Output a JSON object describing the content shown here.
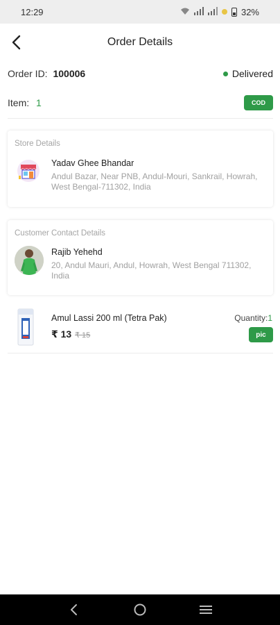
{
  "status_bar": {
    "time": "12:29",
    "battery": "32%"
  },
  "header": {
    "title": "Order Details"
  },
  "order": {
    "id_label": "Order ID:",
    "id_value": "100006",
    "status": "Delivered",
    "item_label": "Item:",
    "item_count": "1",
    "payment_badge": "COD"
  },
  "store": {
    "title": "Store Details",
    "name": "Yadav Ghee Bhandar",
    "address": "Andul Bazar, Near PNB, Andul-Mouri, Sankrail, Howrah, West Bengal-711302, India"
  },
  "customer": {
    "title": "Customer Contact Details",
    "name": "Rajib Yehehd",
    "address": "20, Andul Mauri, Andul, Howrah, West Bengal 711302, India"
  },
  "product": {
    "name": "Amul Lassi 200 ml (Tetra Pak)",
    "price": "₹ 13",
    "mrp": "₹ 15",
    "quantity_label": "Quantity:",
    "quantity_value": "1",
    "pic_badge": "pic"
  },
  "colors": {
    "accent": "#2e9a48",
    "status_bar": "#eeeeee",
    "nav_bar": "#000000"
  },
  "icons": {
    "back": "chevron-left-icon",
    "nav_back": "nav-back-icon",
    "nav_home": "nav-home-icon",
    "nav_menu": "nav-menu-icon"
  }
}
